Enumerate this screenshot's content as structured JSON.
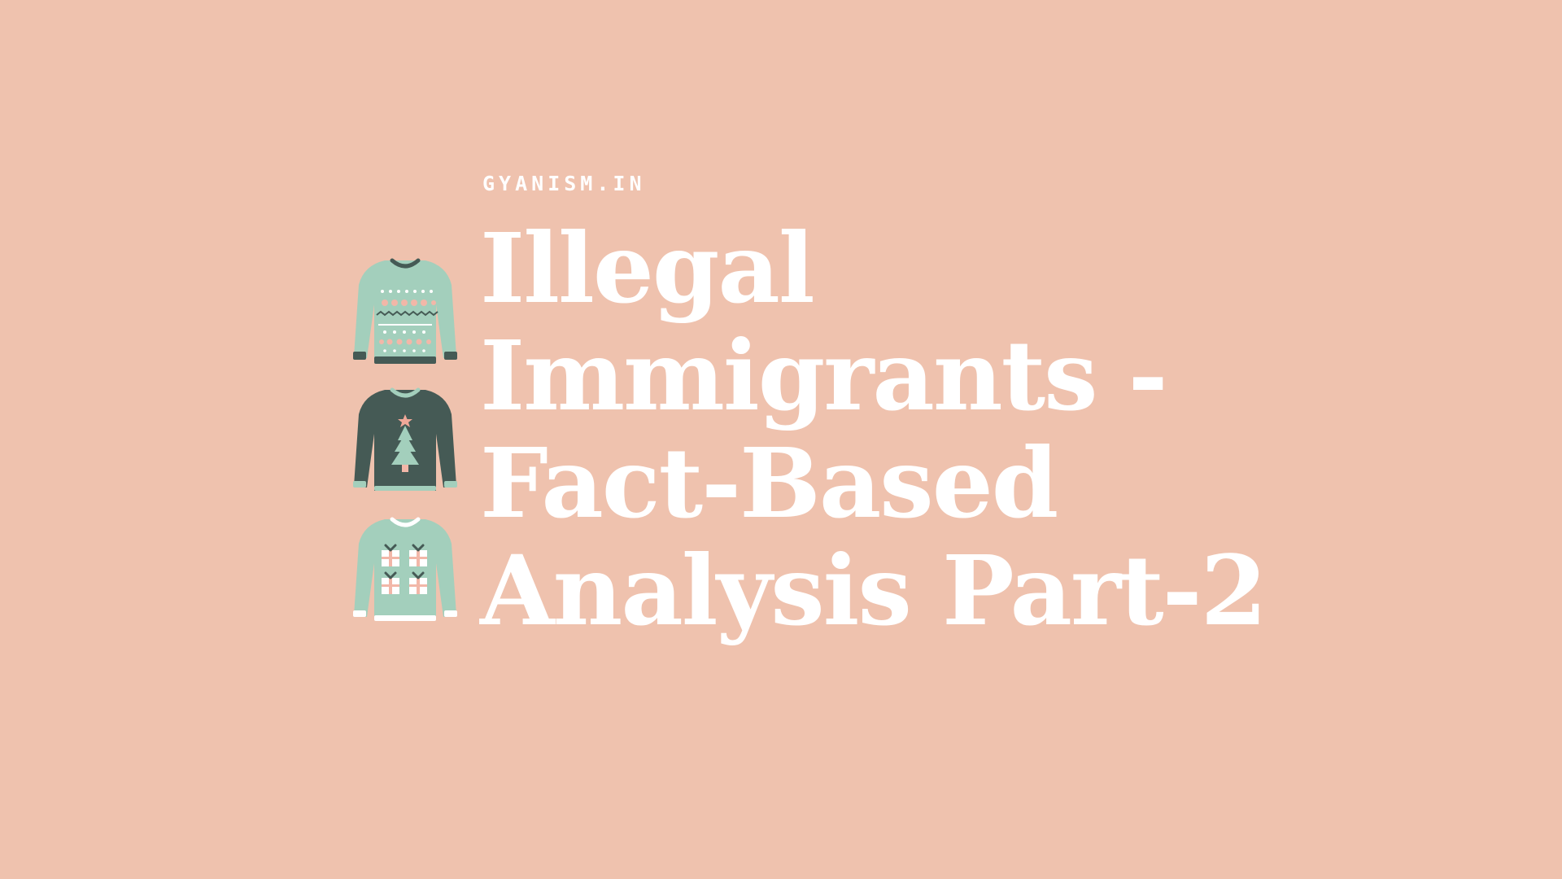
{
  "colors": {
    "background": "#EFC2AE",
    "text": "#FFFFFF",
    "mint": "#A3CFBC",
    "dark_green": "#455A55",
    "pink": "#F2B7A8",
    "white": "#FFFFFF",
    "star": "#F0A898"
  },
  "site": {
    "label": "GYANISM.IN"
  },
  "title": {
    "lines": [
      "Illegal",
      "Immigrants -",
      "Fact-Based",
      "Analysis Part-2"
    ]
  },
  "icons": [
    "fair-isle-sweater-icon",
    "christmas-tree-sweater-icon",
    "gift-box-sweater-icon"
  ]
}
